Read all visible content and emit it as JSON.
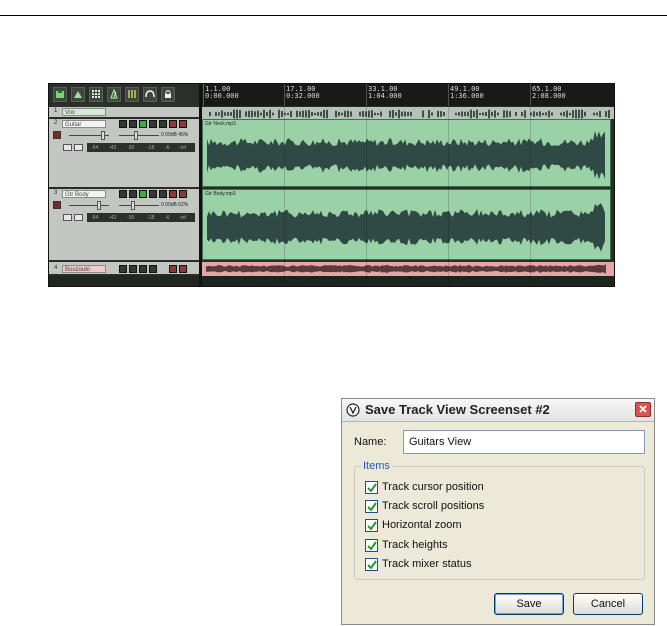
{
  "daw": {
    "ruler": [
      {
        "bar": "1.1.00",
        "time": "0:00.000"
      },
      {
        "bar": "17.1.00",
        "time": "0:32.000"
      },
      {
        "bar": "33.1.00",
        "time": "1:04.000"
      },
      {
        "bar": "49.1.00",
        "time": "1:36.000"
      },
      {
        "bar": "65.1.00",
        "time": "2:08.000"
      }
    ],
    "tracks": [
      {
        "number": "1",
        "name": "Vox"
      },
      {
        "number": "2",
        "name": "Guitar",
        "volume_readout": "0.00dB 45%",
        "meter_scale": [
          "-54",
          "-42",
          "-30",
          "-18",
          "-6",
          "-inf"
        ]
      },
      {
        "number": "3",
        "name": "Gtr Body",
        "volume_readout": "0.00dB 62%",
        "meter_scale": [
          "-54",
          "-42",
          "-30",
          "-18",
          "-6",
          "-inf"
        ]
      },
      {
        "number": "4",
        "name": "Bouzouki"
      }
    ],
    "items": [
      {
        "label": "Gtr Neck.mp3"
      },
      {
        "label": "Gtr Body.mp3"
      }
    ],
    "colors": {
      "item_fill": "#9bd1a7",
      "waveform": "#2f4a44",
      "bouzouki_lane": "#e7a5a5"
    }
  },
  "dialog": {
    "title": "Save Track View Screenset #2",
    "name_label": "Name:",
    "name_value": "Guitars View",
    "group_label": "Items",
    "options": [
      {
        "label": "Track cursor position",
        "checked": true
      },
      {
        "label": "Track scroll positions",
        "checked": true
      },
      {
        "label": "Horizontal zoom",
        "checked": true
      },
      {
        "label": "Track heights",
        "checked": true
      },
      {
        "label": "Track mixer status",
        "checked": true
      }
    ],
    "save_label": "Save",
    "cancel_label": "Cancel",
    "colors": {
      "close_button": "#d9534f",
      "check_mark": "#1c9e2c"
    }
  }
}
